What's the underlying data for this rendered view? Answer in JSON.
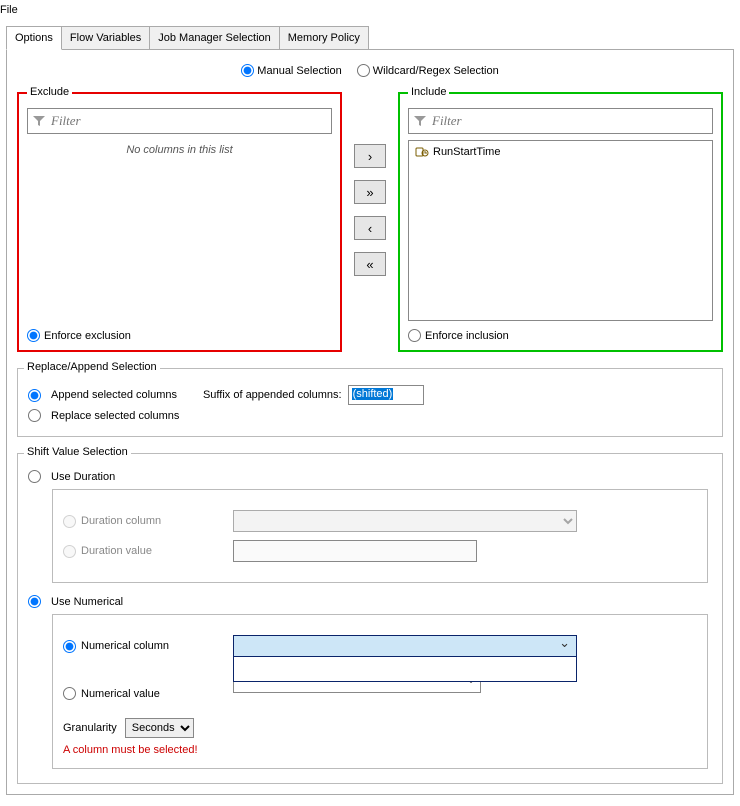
{
  "menu": {
    "file": "File"
  },
  "tabs": {
    "options": "Options",
    "flow_variables": "Flow Variables",
    "job_manager": "Job Manager Selection",
    "memory_policy": "Memory Policy"
  },
  "selection_mode": {
    "manual": "Manual Selection",
    "wildcard": "Wildcard/Regex Selection"
  },
  "exclude": {
    "title": "Exclude",
    "filter_placeholder": "Filter",
    "empty_message": "No columns in this list",
    "enforce": "Enforce exclusion"
  },
  "include": {
    "title": "Include",
    "filter_placeholder": "Filter",
    "items": [
      "RunStartTime"
    ],
    "enforce": "Enforce inclusion"
  },
  "transfer": {
    "right": "›",
    "right_all": "»",
    "left": "‹",
    "left_all": "«"
  },
  "replace_append": {
    "title": "Replace/Append Selection",
    "append": "Append selected columns",
    "suffix_label": "Suffix of appended columns:",
    "suffix_value": "(shifted)",
    "replace": "Replace selected columns"
  },
  "shift_value": {
    "title": "Shift Value Selection",
    "use_duration": "Use Duration",
    "duration_column": "Duration column",
    "duration_value": "Duration value",
    "use_numerical": "Use Numerical",
    "numerical_column": "Numerical column",
    "numerical_value": "Numerical value",
    "granularity": "Granularity",
    "granularity_value": "Seconds",
    "error": "A column must be selected!"
  }
}
